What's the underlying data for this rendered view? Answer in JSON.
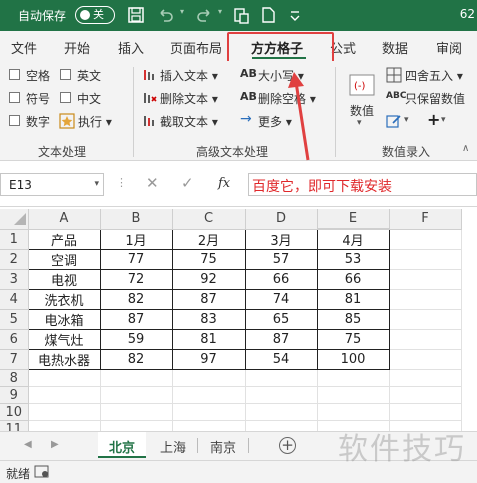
{
  "titlebar": {
    "autosave_label": "自动保存",
    "autosave_state": "关",
    "filename_fragment": "62"
  },
  "tabs": [
    "文件",
    "开始",
    "插入",
    "页面布局",
    "方方格子",
    "公式",
    "数据",
    "审阅"
  ],
  "active_tab": "方方格子",
  "ribbon": {
    "text_processing": {
      "checkboxes": [
        "空格",
        "英文",
        "符号",
        "中文",
        "数字"
      ],
      "execute": "执行",
      "group_label": "文本处理"
    },
    "advanced_text": {
      "insert_text": "插入文本",
      "delete_text": "删除文本",
      "truncate_text": "截取文本",
      "case": "大小写",
      "delete_space": "删除空格",
      "more": "更多",
      "group_label": "高级文本处理"
    },
    "numeric_entry": {
      "value_button": "数值",
      "round": "四舍五入",
      "keep_values": "只保留数值",
      "group_label": "数值录入"
    }
  },
  "formula_bar": {
    "name_box": "E13",
    "fx_label": "fx",
    "formula_text": "百度它，即可下载安装"
  },
  "grid": {
    "columns": [
      "A",
      "B",
      "C",
      "D",
      "E",
      "F"
    ],
    "selected_column": "E",
    "row_numbers": [
      "1",
      "2",
      "3",
      "4",
      "5",
      "6",
      "7",
      "8",
      "9",
      "10",
      "11"
    ],
    "header_row": [
      "产品",
      "1月",
      "2月",
      "3月",
      "4月"
    ],
    "rows": [
      [
        "空调",
        "77",
        "75",
        "57",
        "53"
      ],
      [
        "电视",
        "72",
        "92",
        "66",
        "66"
      ],
      [
        "洗衣机",
        "82",
        "87",
        "74",
        "81"
      ],
      [
        "电冰箱",
        "87",
        "83",
        "65",
        "85"
      ],
      [
        "煤气灶",
        "59",
        "81",
        "87",
        "75"
      ],
      [
        "电热水器",
        "82",
        "97",
        "54",
        "100"
      ]
    ]
  },
  "sheets": {
    "tabs": [
      "北京",
      "上海",
      "南京"
    ],
    "active": "北京",
    "add_label": "+"
  },
  "status": {
    "text": "就绪"
  },
  "watermark": "软件技巧",
  "colors": {
    "accent": "#217346",
    "highlight": "#e04040",
    "formula_text": "#e0282b",
    "selected_header": "#d7e9dd"
  }
}
